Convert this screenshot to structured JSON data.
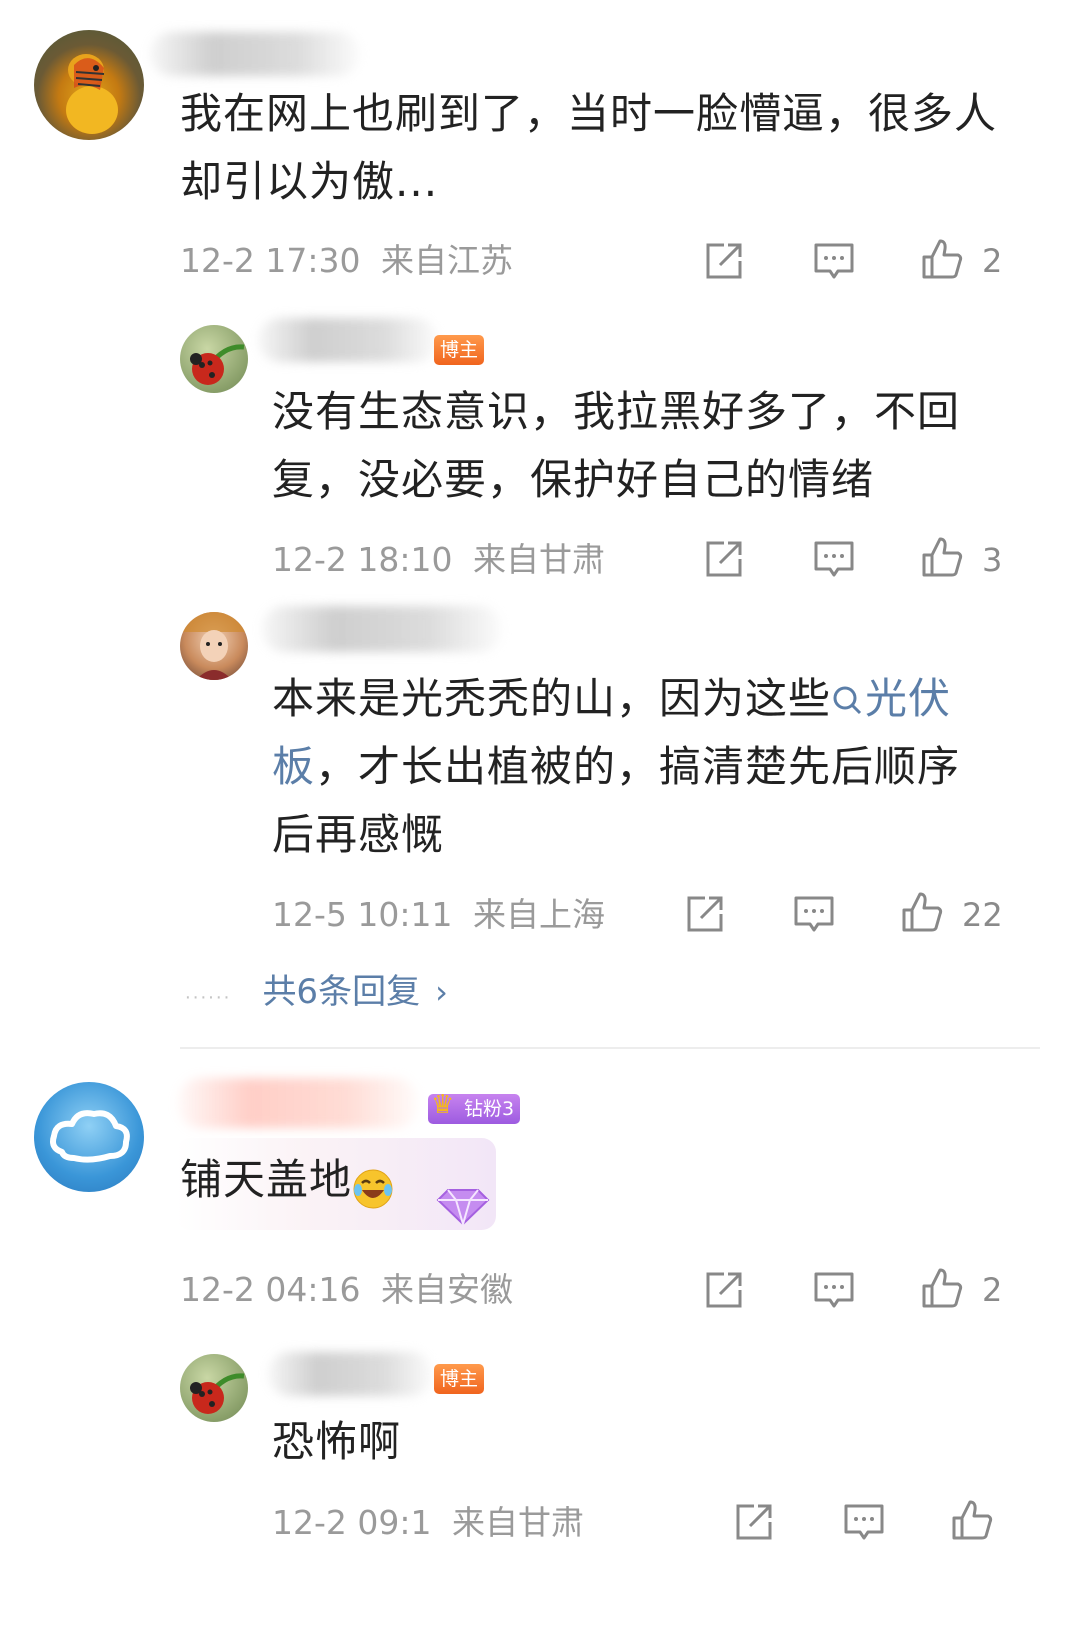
{
  "comments": [
    {
      "text": "我在网上也刷到了，当时一脸懵逼，很多人却引以为傲...",
      "time": "12-2 17:30",
      "location": "来自江苏",
      "likes": "2",
      "replies": [
        {
          "badge": "博主",
          "text": "没有生态意识，我拉黑好多了，不回复，没必要，保护好自己的情绪",
          "time": "12-2 18:10",
          "location": "来自甘肃",
          "likes": "3"
        },
        {
          "text_before": "本来是光秃秃的山，因为这些",
          "link_icon": "search-icon",
          "link_text_a": "光伏",
          "link_text_b": "板",
          "text_after": "，才长出植被的，搞清楚先后顺序后再感慨",
          "time": "12-5 10:11",
          "location": "来自上海",
          "likes": "22"
        }
      ],
      "more_replies": "共6条回复",
      "more_dots": "······"
    },
    {
      "badge": "钻粉3",
      "text": "铺天盖地",
      "time": "12-2 04:16",
      "location": "来自安徽",
      "likes": "2",
      "replies": [
        {
          "badge": "博主",
          "text": "恐怖啊",
          "time": "12-2 09:1",
          "location": "来自甘肃"
        }
      ]
    }
  ],
  "colors": {
    "link": "#5b7ea8",
    "blogger_badge": "#f0641e",
    "fan_badge": "#9d5be0",
    "meta_text": "#9a9a9a"
  }
}
